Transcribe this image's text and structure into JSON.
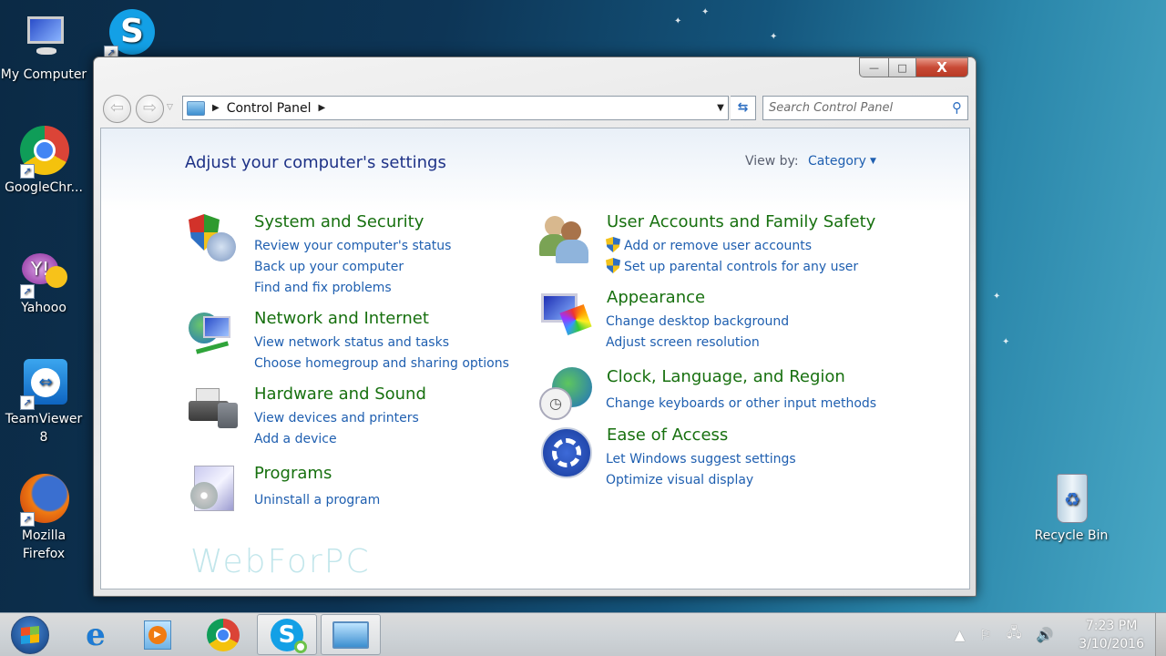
{
  "desktop": {
    "icons": [
      {
        "label": "My Computer",
        "icon": "computer-icon"
      },
      {
        "label": "",
        "icon": "skype-icon"
      },
      {
        "label": "GoogleChr...",
        "icon": "chrome-icon"
      },
      {
        "label": "Yahooo",
        "icon": "yahoo-messenger-icon"
      },
      {
        "label": "TeamViewer 8",
        "icon": "teamviewer-icon"
      },
      {
        "label": "Mozilla Firefox",
        "icon": "firefox-icon"
      },
      {
        "label": "Recycle Bin",
        "icon": "recycle-bin-icon"
      }
    ]
  },
  "window": {
    "caption": {
      "minimize": "—",
      "maximize": "□",
      "close": "X"
    },
    "address": {
      "crumbs": [
        "Control Panel"
      ]
    },
    "search": {
      "placeholder": "Search Control Panel"
    },
    "content": {
      "title": "Adjust your computer's settings",
      "view_by_label": "View by:",
      "view_by_value": "Category",
      "categories": [
        {
          "title": "System and Security",
          "icon": "system-security-icon",
          "links": [
            "Review your computer's status",
            "Back up your computer",
            "Find and fix problems"
          ]
        },
        {
          "title": "Network and Internet",
          "icon": "network-icon",
          "links": [
            "View network status and tasks",
            "Choose homegroup and sharing options"
          ]
        },
        {
          "title": "Hardware and Sound",
          "icon": "printer-icon",
          "links": [
            "View devices and printers",
            "Add a device"
          ]
        },
        {
          "title": "Programs",
          "icon": "programs-icon",
          "links": [
            "Uninstall a program"
          ]
        },
        {
          "title": "User Accounts and Family Safety",
          "icon": "users-icon",
          "links": [
            "Add or remove user accounts",
            "Set up parental controls for any user"
          ]
        },
        {
          "title": "Appearance",
          "icon": "appearance-icon",
          "links": [
            "Change desktop background",
            "Adjust screen resolution"
          ]
        },
        {
          "title": "Clock, Language, and Region",
          "icon": "clock-globe-icon",
          "links": [
            "Change keyboards or other input methods"
          ]
        },
        {
          "title": "Ease of Access",
          "icon": "ease-of-access-icon",
          "links": [
            "Let Windows suggest settings",
            "Optimize visual display"
          ]
        }
      ],
      "watermark": "WebForPC"
    }
  },
  "taskbar": {
    "items": [
      "start",
      "internet-explorer",
      "media-player",
      "chrome",
      "skype",
      "control-panel"
    ],
    "clock": {
      "time": "7:23 PM",
      "date": "3/10/2016"
    }
  }
}
